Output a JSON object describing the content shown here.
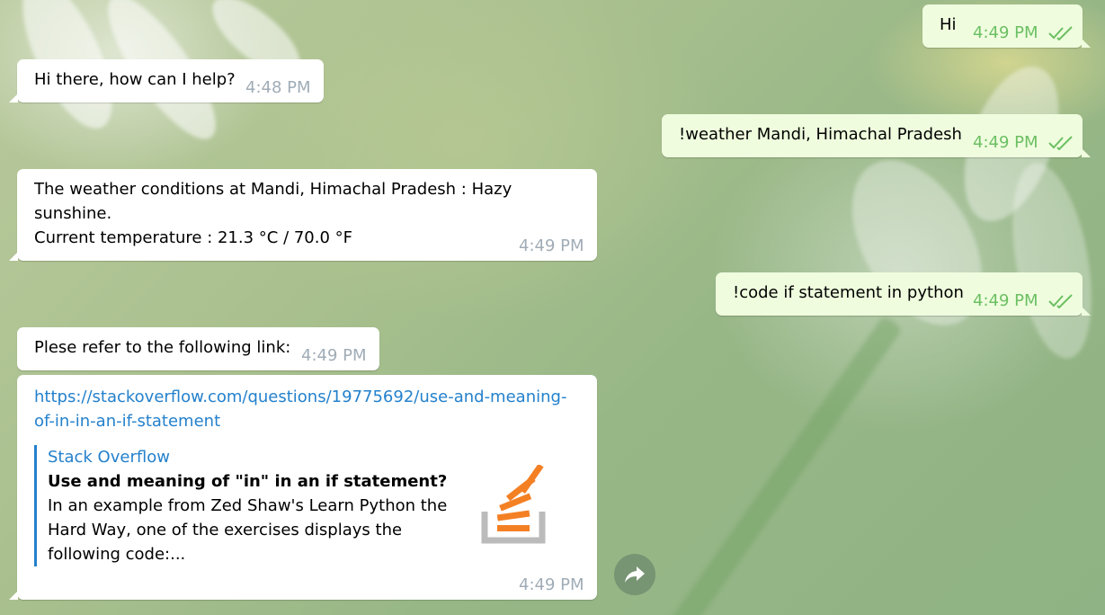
{
  "messages": [
    {
      "text": "Hi",
      "time": "4:49 PM"
    },
    {
      "text": "Hi there, how can I help?",
      "time": "4:48 PM"
    },
    {
      "text": "!weather Mandi, Himachal Pradesh",
      "time": "4:49 PM"
    },
    {
      "line1": "The weather conditions at Mandi, Himachal Pradesh : Hazy",
      "line2": "sunshine.",
      "line3": "Current temperature : 21.3 °C / 70.0 °F",
      "time": "4:49 PM"
    },
    {
      "text": "!code if statement in python",
      "time": "4:49 PM"
    },
    {
      "text": "Plese refer to the following link:",
      "time": "4:49 PM"
    },
    {
      "link_line1": "https://stackoverflow.com/questions/19775692/use-and-meaning-",
      "link_line2": "of-in-in-an-if-statement",
      "site": "Stack Overflow",
      "title": "Use and meaning of \"in\" in an if statement?",
      "desc_line1": "In an example from Zed Shaw's Learn Python the",
      "desc_line2": "Hard Way, one of the exercises displays the",
      "desc_line3": "following code:...",
      "time": "4:49 PM"
    }
  ],
  "icons": {
    "read_receipt": "double-check-icon",
    "preview_image": "stackoverflow-logo-icon",
    "share": "share-icon"
  },
  "colors": {
    "incoming_bubble": "#ffffff",
    "outgoing_bubble": "#effdde",
    "outgoing_time": "#6cbf63",
    "link": "#2481cc",
    "so_orange": "#f48024",
    "so_gray": "#bcbbbb"
  }
}
